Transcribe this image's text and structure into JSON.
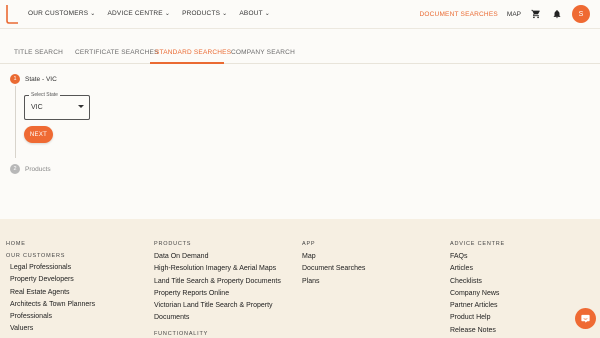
{
  "header": {
    "nav": [
      {
        "label": "OUR CUSTOMERS"
      },
      {
        "label": "ADVICE CENTRE"
      },
      {
        "label": "PRODUCTS"
      },
      {
        "label": "ABOUT"
      }
    ],
    "document_searches": "DOCUMENT SEARCHES",
    "map": "MAP",
    "avatar_initial": "S",
    "accent": "#ea6a32"
  },
  "tabs": [
    {
      "label": "TITLE SEARCH"
    },
    {
      "label": "CERTIFICATE SEARCHES"
    },
    {
      "label": "STANDARD SEARCHES"
    },
    {
      "label": "COMPANY SEARCH"
    }
  ],
  "active_tab": "STANDARD SEARCHES",
  "stepper": {
    "step1": {
      "num": "1",
      "label": "State - VIC"
    },
    "select": {
      "legend": "Select State",
      "value": "VIC"
    },
    "next": "NEXT",
    "step2": {
      "num": "2",
      "label": "Products"
    }
  },
  "footer": {
    "col1": {
      "head": "HOME",
      "sub": "OUR CUSTOMERS",
      "links": [
        "Legal Professionals",
        "Property Developers",
        "Real Estate Agents",
        "Architects & Town Planners",
        "Professionals",
        "Valuers"
      ]
    },
    "col2": {
      "head": "PRODUCTS",
      "links": [
        "Data On Demand",
        "High-Resolution Imagery & Aerial Maps",
        "Land Title Search & Property Documents",
        "Property Reports Online",
        "Victorian Land Title Search & Property",
        "Documents"
      ],
      "sub": "FUNCTIONALITY"
    },
    "col3": {
      "head": "APP",
      "links": [
        "Map",
        "Document Searches",
        "Plans"
      ]
    },
    "col4": {
      "head": "ADVICE CENTRE",
      "links": [
        "FAQs",
        "Articles",
        "Checklists",
        "Company News",
        "Partner Articles",
        "Product Help",
        "Release Notes"
      ]
    }
  }
}
